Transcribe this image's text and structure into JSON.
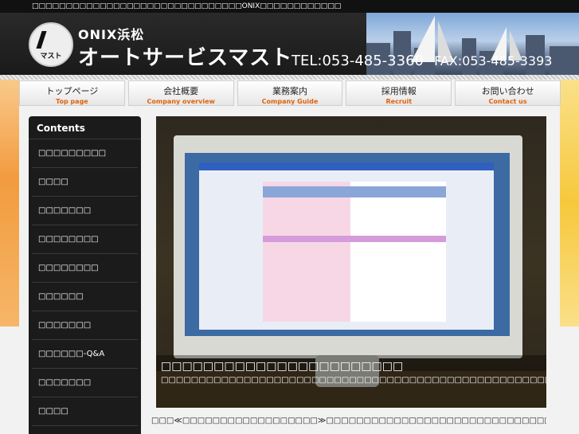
{
  "top_strip": {
    "text": "□□□□□□□□□□□□□□□□□□□□□□□□□□□□□□□ONIX□□□□□□□□□□□□"
  },
  "header": {
    "logo_text": "マスト",
    "brand_small": "ONIX浜松",
    "brand_big": "オートサービスマスト",
    "tel": "TEL:053-485-3360",
    "fax": "FAX:053-485-3393"
  },
  "nav": [
    {
      "jp": "トップページ",
      "en": "Top page"
    },
    {
      "jp": "会社概要",
      "en": "Company overview"
    },
    {
      "jp": "業務案内",
      "en": "Company Guide"
    },
    {
      "jp": "採用情報",
      "en": "Recruit"
    },
    {
      "jp": "お問い合わせ",
      "en": "Contact us"
    }
  ],
  "sidebar": {
    "title": "Contents",
    "items": [
      "□□□□□□□□□",
      "□□□□",
      "□□□□□□□",
      "□□□□□□□□",
      "□□□□□□□□",
      "□□□□□□",
      "□□□□□□□",
      "□□□□□□-Q&A",
      "□□□□□□□",
      "□□□□"
    ]
  },
  "photo": {
    "caption_title": "□□□□□□□□□□□□□□□□□□□□□□□",
    "caption_sub": "□□□□□□□□□□□□□□□□□□□□□□□□□□□□□□□□□□□□□□□□□□□□□□□□□□□□□□□□□□□□□□□□□□□□□□"
  },
  "article": {
    "line1": "□□□≪□□□□□□□□□□□□□□□□□□≫□□□□□□□□□□□□□□□□□□□□□□□□□□□□□□□□□□□□□□□□□□□□□□□□□□□□□□□□□□□"
  },
  "colors": {
    "nav_en": "#e2620a",
    "sidebar_bg": "#1b1b1b",
    "header_bg": "#1a1a1a"
  }
}
